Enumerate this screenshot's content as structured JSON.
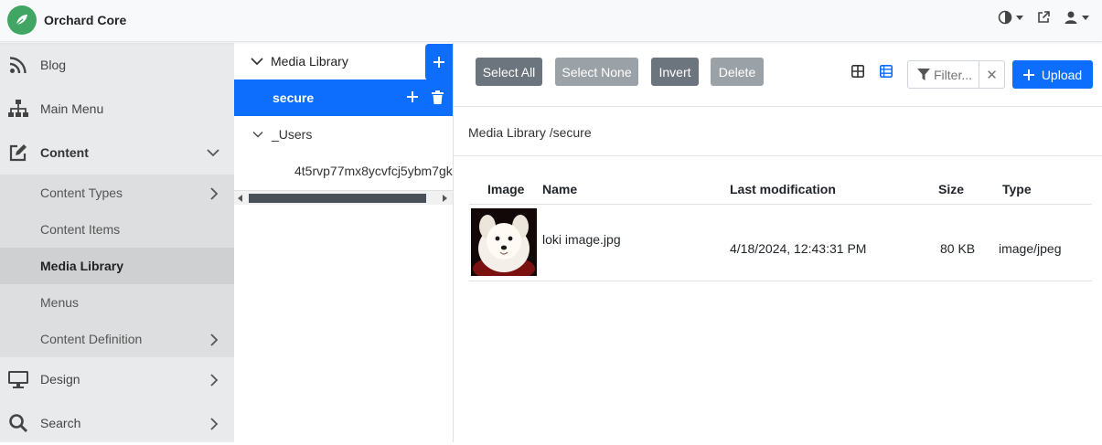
{
  "app": {
    "title": "Orchard Core",
    "icons": [
      "theme-toggle-icon",
      "external-link-icon",
      "user-icon"
    ]
  },
  "sidebar": {
    "items": [
      {
        "label": "Blog",
        "icon": "rss-icon"
      },
      {
        "label": "Main Menu",
        "icon": "sitemap-icon"
      },
      {
        "label": "Content",
        "icon": "edit-icon",
        "expanded": true
      },
      {
        "label": "Design",
        "icon": "monitor-icon"
      },
      {
        "label": "Search",
        "icon": "search-icon"
      }
    ],
    "content_subitems": [
      {
        "label": "Content Types",
        "has_children": true
      },
      {
        "label": "Content Items"
      },
      {
        "label": "Media Library",
        "active": true
      },
      {
        "label": "Menus"
      },
      {
        "label": "Content Definition",
        "has_children": true
      }
    ]
  },
  "tree": {
    "root_label": "Media Library",
    "selected_label": "secure",
    "users_label": "_Users",
    "leaf_label": "4t5rvp77mx8ycvfcj5ybm7gk"
  },
  "toolbar": {
    "select_all": "Select All",
    "select_none": "Select None",
    "invert": "Invert",
    "delete": "Delete",
    "filter_placeholder": "Filter...",
    "upload": "Upload"
  },
  "breadcrumb": "Media Library /secure",
  "table": {
    "headers": [
      "Image",
      "Name",
      "Last modification",
      "Size",
      "Type"
    ],
    "rows": [
      {
        "name": "loki image.jpg",
        "modified": "4/18/2024, 12:43:31 PM",
        "size": "80 KB",
        "type": "image/jpeg"
      }
    ]
  },
  "colors": {
    "primary": "#0d6efd",
    "brand": "#41a564",
    "sidebar": "#e9eaeb"
  }
}
